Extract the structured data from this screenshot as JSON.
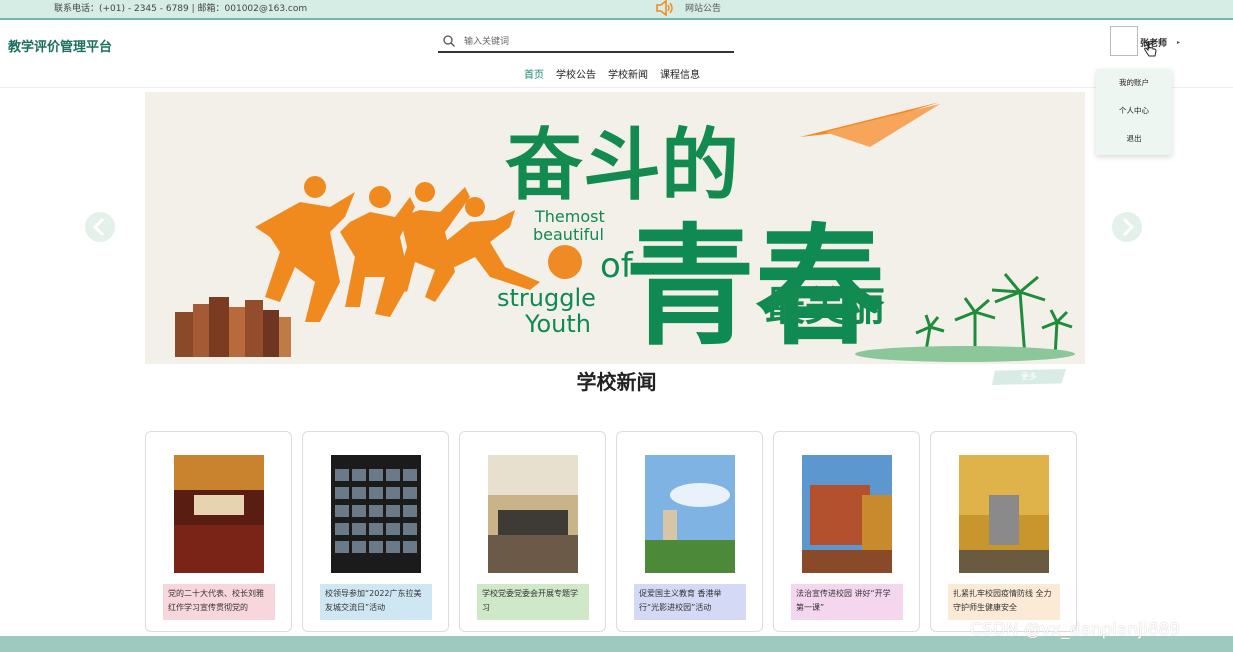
{
  "topbar": {
    "contact": "联系电话：(+01) - 2345 - 6789 | 邮箱：001002@163.com",
    "notice_label": "网站公告"
  },
  "header": {
    "brand": "教学评价管理平台",
    "search_placeholder": "输入关键词",
    "nav": [
      {
        "label": "首页",
        "active": true
      },
      {
        "label": "学校公告"
      },
      {
        "label": "学校新闻"
      },
      {
        "label": "课程信息"
      }
    ],
    "user": {
      "name": "张老师"
    }
  },
  "dropdown": {
    "items": [
      "我的账户",
      "个人中心",
      "退出"
    ]
  },
  "banner": {
    "headline_top": "奋斗的",
    "headline_main": "青春",
    "headline_tail": "最美丽",
    "en_line1": "Themost",
    "en_line2": "beautiful",
    "en_line3": "of",
    "en_line4": "struggle",
    "en_line5": "Youth"
  },
  "news": {
    "title": "学校新闻",
    "more": "更多",
    "items": [
      {
        "caption": "党的二十大代表、校长刘雅红作学习宣传贯彻党的",
        "color": "#f7d6dc"
      },
      {
        "caption": "校领导参加“2022广东拉美友城交流日”活动",
        "color": "#cfe6f3"
      },
      {
        "caption": "学校党委党委会开展专题学习",
        "color": "#cfe8c8"
      },
      {
        "caption": "促爱国主义教育 香港举行“光影进校园”活动",
        "color": "#d4daf5"
      },
      {
        "caption": "法治宣传进校园 讲好“开学第一课”",
        "color": "#f5d6ef"
      },
      {
        "caption": "扎紧扎牢校园疫情防线 全力守护师生健康安全",
        "color": "#fbead6"
      }
    ]
  },
  "watermark": "CSDN @vx_danpianji889"
}
